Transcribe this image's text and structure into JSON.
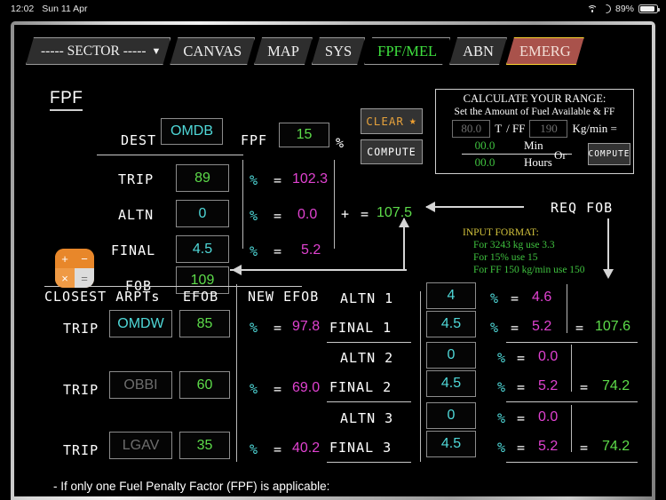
{
  "statusbar": {
    "time": "12:02",
    "date": "Sun 11 Apr",
    "battery": "89%",
    "wifi_icon": "wifi-icon",
    "moon_icon": "crescent-moon-icon",
    "battery_icon": "battery-icon"
  },
  "tabs": [
    {
      "label": "----- SECTOR -----",
      "caret": "▼",
      "state": "dropdown"
    },
    {
      "label": "CANVAS",
      "state": "normal"
    },
    {
      "label": "MAP",
      "state": "normal"
    },
    {
      "label": "SYS",
      "state": "normal"
    },
    {
      "label": "FPF/MEL",
      "state": "active"
    },
    {
      "label": "ABN",
      "state": "normal"
    },
    {
      "label": "EMERG",
      "state": "emergency"
    }
  ],
  "page": {
    "title": "FPF"
  },
  "top": {
    "dest_label": "DEST",
    "dest_value": "OMDB",
    "fpf_label": "FPF",
    "fpf_value": "15",
    "pct_symbol": "%",
    "rows": [
      {
        "label": "TRIP",
        "value": "89",
        "pct": "%",
        "eq": "=",
        "result": "102.3"
      },
      {
        "label": "ALTN",
        "value": "0",
        "pct": "%",
        "eq": "=",
        "result": "0.0"
      },
      {
        "label": "FINAL",
        "value": "4.5",
        "pct": "%",
        "eq": "=",
        "result": "5.2"
      },
      {
        "label": "FOB",
        "value": "109"
      }
    ],
    "plus": "+",
    "eq": "=",
    "sum": "107.5",
    "req_fob_label": "REQ FOB"
  },
  "buttons": {
    "clear": "CLEAR",
    "clear_star": "★",
    "compute": "COMPUTE",
    "range_compute": "COMPUTE"
  },
  "range": {
    "title": "CALCULATE YOUR RANGE:",
    "subtitle": "Set the Amount of Fuel Available & FF",
    "fuel_placeholder": "80.0",
    "unit_t": "T",
    "ff_label": "/ FF",
    "ff_placeholder": "190",
    "unit_kgmin": "Kg/min =",
    "min_value": "00.0",
    "min_unit": "Min",
    "hours_value": "00.0",
    "hours_unit": "Hours",
    "or": "Or"
  },
  "note": {
    "heading": "INPUT FORMAT:",
    "lines": [
      "For 3243 kg use 3.3",
      "For 15% use 15",
      "For FF 150 kg/min use 150"
    ]
  },
  "bottom": {
    "closest_label": "CLOSEST ARPTs",
    "efob_label": "EFOB",
    "new_efob_label": "NEW EFOB",
    "arpt_rows": [
      {
        "trip_label": "TRIP",
        "arpt": "OMDW",
        "arpt_is_placeholder": false,
        "efob": "85",
        "pct": "%",
        "eq": "=",
        "new_efob": "97.8"
      },
      {
        "trip_label": "TRIP",
        "arpt": "OBBI",
        "arpt_is_placeholder": true,
        "efob": "60",
        "pct": "%",
        "eq": "=",
        "new_efob": "69.0"
      },
      {
        "trip_label": "TRIP",
        "arpt": "LGAV",
        "arpt_is_placeholder": true,
        "efob": "35",
        "pct": "%",
        "eq": "=",
        "new_efob": "40.2"
      }
    ],
    "altn_groups": [
      {
        "altn_label": "ALTN 1",
        "altn_value": "4",
        "altn_pct": "%",
        "altn_eq": "=",
        "altn_result": "4.6",
        "final_label": "FINAL 1",
        "final_value": "4.5",
        "final_pct": "%",
        "final_eq": "=",
        "final_result": "5.2",
        "total_eq": "=",
        "total": "107.6"
      },
      {
        "altn_label": "ALTN 2",
        "altn_value": "0",
        "altn_pct": "%",
        "altn_eq": "=",
        "altn_result": "0.0",
        "final_label": "FINAL 2",
        "final_value": "4.5",
        "final_pct": "%",
        "final_eq": "=",
        "final_result": "5.2",
        "total_eq": "=",
        "total": "74.2"
      },
      {
        "altn_label": "ALTN 3",
        "altn_value": "0",
        "altn_pct": "%",
        "altn_eq": "=",
        "altn_result": "0.0",
        "final_label": "FINAL 3",
        "final_value": "4.5",
        "final_pct": "%",
        "final_eq": "=",
        "final_result": "5.2",
        "total_eq": "=",
        "total": "74.2"
      }
    ]
  },
  "footnote": "- If only one Fuel Penalty Factor (FPF) is applicable:",
  "colors": {
    "cyan": "#4fd8d8",
    "green": "#5ddc4a",
    "magenta": "#e042d0",
    "amber": "#e5a13c",
    "emerg": "#a9524b"
  }
}
